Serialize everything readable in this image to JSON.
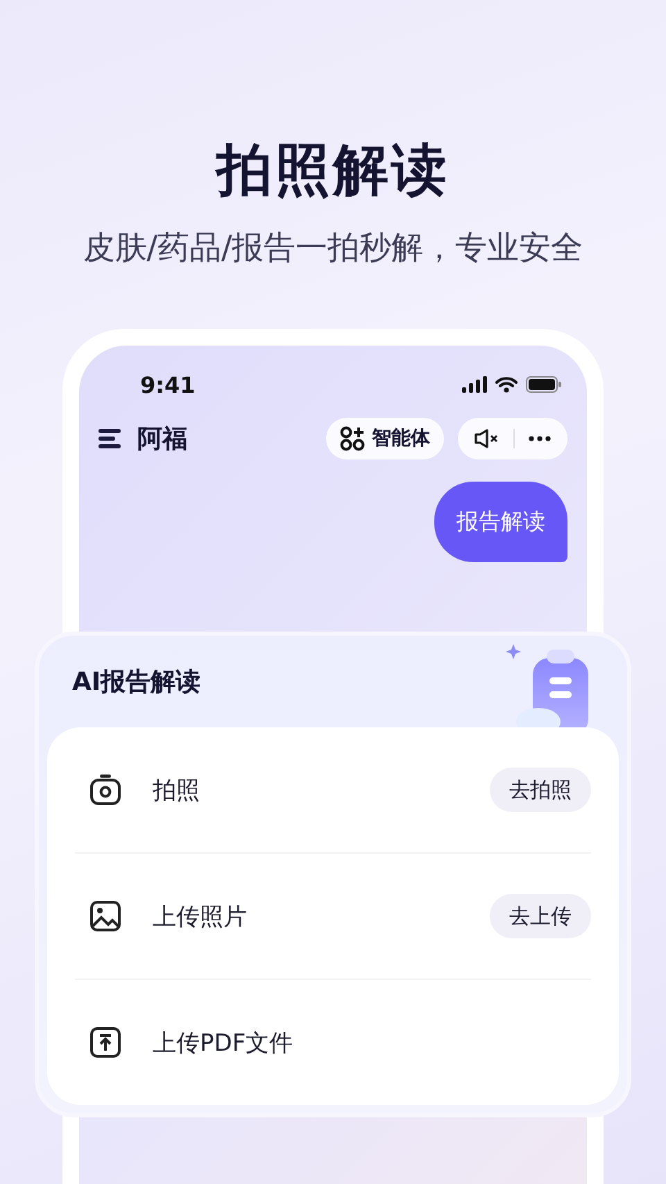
{
  "headline": "拍照解读",
  "subtitle": "皮肤/药品/报告一拍秒解，专业安全",
  "status_bar": {
    "time": "9:41"
  },
  "nav": {
    "title": "阿福",
    "agent_button": "智能体"
  },
  "chat": {
    "bubble": "报告解读"
  },
  "sheet": {
    "title": "AI报告解读",
    "options": [
      {
        "kind": "camera",
        "label": "拍照",
        "action": "去拍照"
      },
      {
        "kind": "image",
        "label": "上传照片",
        "action": "去上传"
      },
      {
        "kind": "upload",
        "label": "上传PDF文件"
      }
    ]
  }
}
